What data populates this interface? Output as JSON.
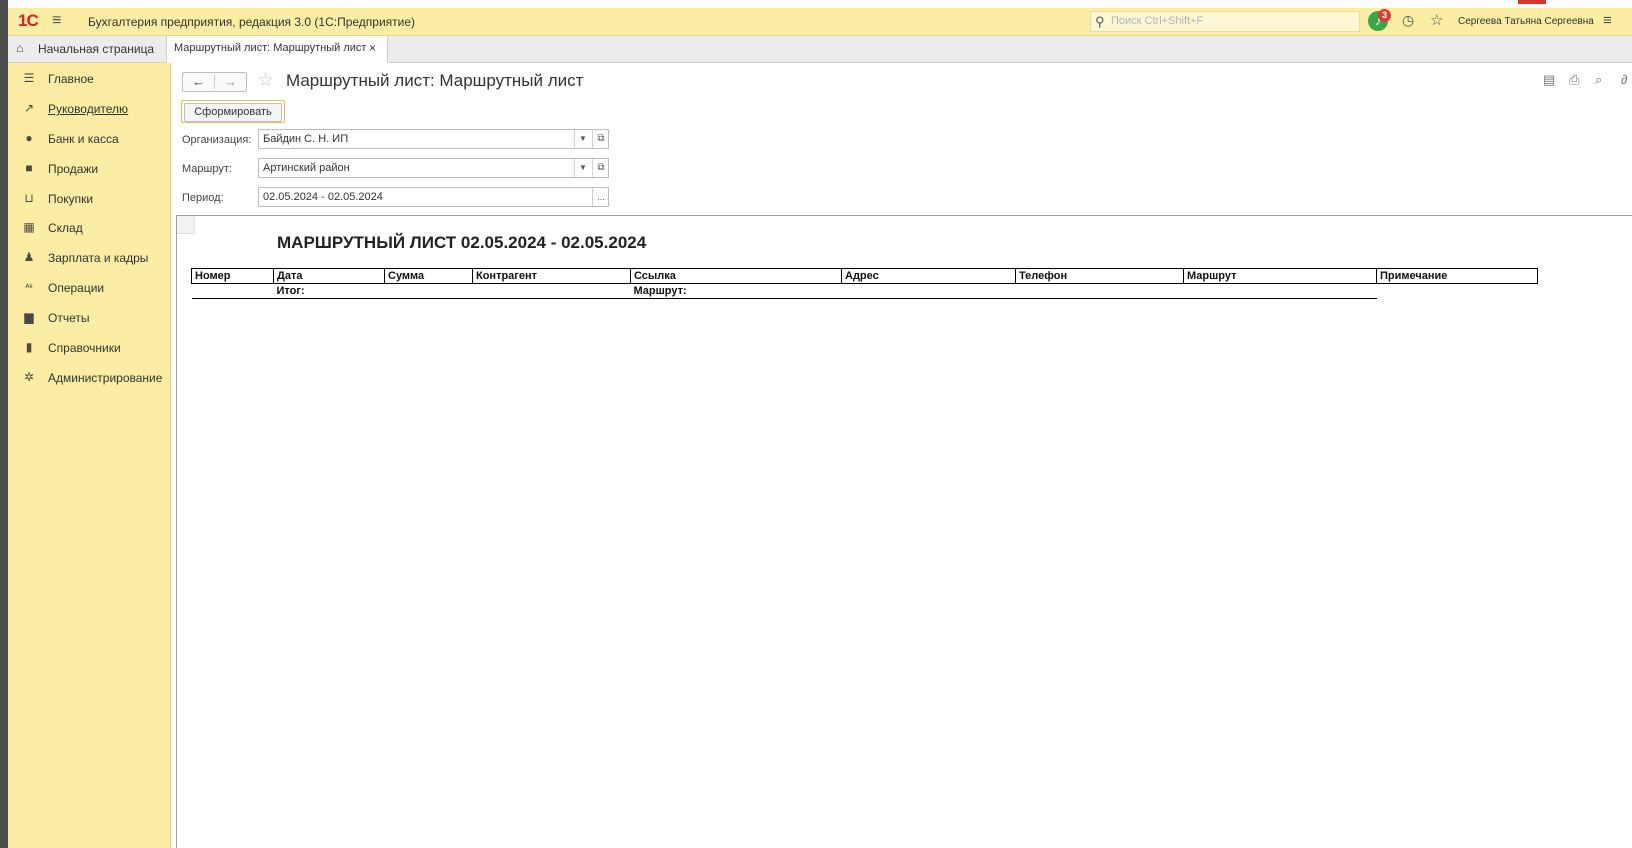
{
  "app": {
    "title": "Бухгалтерия предприятия, редакция 3.0  (1С:Предприятие)",
    "logo": "1С",
    "search_placeholder": "Поиск Ctrl+Shift+F",
    "notifications_count": "3",
    "user": "Сергеева Татьяна Сергеевна"
  },
  "tabs": {
    "home": "Начальная страница",
    "active": "Маршрутный лист: Маршрутный лист",
    "close": "×"
  },
  "sidebar": {
    "items": [
      {
        "label": "Главное",
        "icon": "list-icon"
      },
      {
        "label": "Руководителю",
        "icon": "trend-icon"
      },
      {
        "label": "Банк и касса",
        "icon": "bank-icon"
      },
      {
        "label": "Продажи",
        "icon": "bag-icon"
      },
      {
        "label": "Покупки",
        "icon": "cart-icon"
      },
      {
        "label": "Склад",
        "icon": "warehouse-icon"
      },
      {
        "label": "Зарплата и кадры",
        "icon": "person-icon"
      },
      {
        "label": "Операции",
        "icon": "operations-icon"
      },
      {
        "label": "Отчеты",
        "icon": "chart-icon"
      },
      {
        "label": "Справочники",
        "icon": "book-icon"
      },
      {
        "label": "Администрирование",
        "icon": "gear-icon"
      }
    ]
  },
  "form": {
    "title": "Маршрутный лист: Маршрутный лист",
    "generate_button": "Сформировать",
    "org_label": "Организация:",
    "org_value": "Байдин С. Н. ИП",
    "route_label": "Маршрут:",
    "route_value": "Артинский район",
    "period_label": "Период:",
    "period_value": "02.05.2024 - 02.05.2024",
    "period_button": "..."
  },
  "report": {
    "title": "МАРШРУТНЫЙ ЛИСТ 02.05.2024 - 02.05.2024",
    "columns": [
      "Номер",
      "Дата",
      "Сумма",
      "Контрагент",
      "Ссылка",
      "Адрес",
      "Телефон",
      "Маршрут",
      "Примечание"
    ],
    "total_row": {
      "itog": "Итог:",
      "route": "Маршрут:"
    }
  }
}
